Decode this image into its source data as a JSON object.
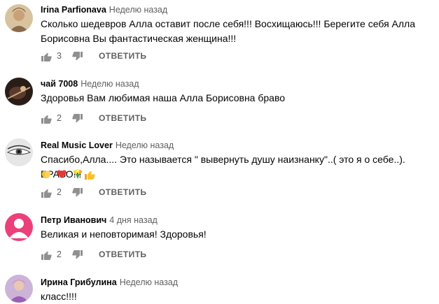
{
  "comments": [
    {
      "author": "Irina Parfionava",
      "time": "Неделю назад",
      "text": "Сколько шедевров Алла оставит после себя!!! Восхищаюсь!!! Берегите себя Алла Борисовна Вы фантастическая женщина!!!",
      "likes": "3",
      "reply": "ОТВЕТИТЬ",
      "avatar_color": "#c9a97a"
    },
    {
      "author": "чай 7008",
      "time": "Неделю назад",
      "text": "Здоровья Вам любимая наша Алла Борисовна браво",
      "likes": "2",
      "reply": "ОТВЕТИТЬ",
      "avatar_color": "#3b2a22"
    },
    {
      "author": "Real Music Lover",
      "time": "Неделю назад",
      "text": "Спасибо,Алла.... Это называется \" вывернуть душу наизнанку\"..( это я о себе..). БРАВО!!!",
      "likes": "2",
      "reply": "ОТВЕТИТЬ",
      "avatar_color": "#9a9a9a",
      "emojis": [
        "thumbs-up-icon",
        "clapping-hands-icon",
        "heart-icon",
        "bouquet-icon"
      ]
    },
    {
      "author": "Петр Иванович",
      "time": "4 дня назад",
      "text": "Великая и неповторимая! Здоровья!",
      "likes": "2",
      "reply": "ОТВЕТИТЬ",
      "avatar_color": "#ec407a"
    },
    {
      "author": "Ирина Грибулина",
      "time": "Неделю назад",
      "text": "класс!!!!",
      "avatar_color": "#b58fc7"
    }
  ]
}
